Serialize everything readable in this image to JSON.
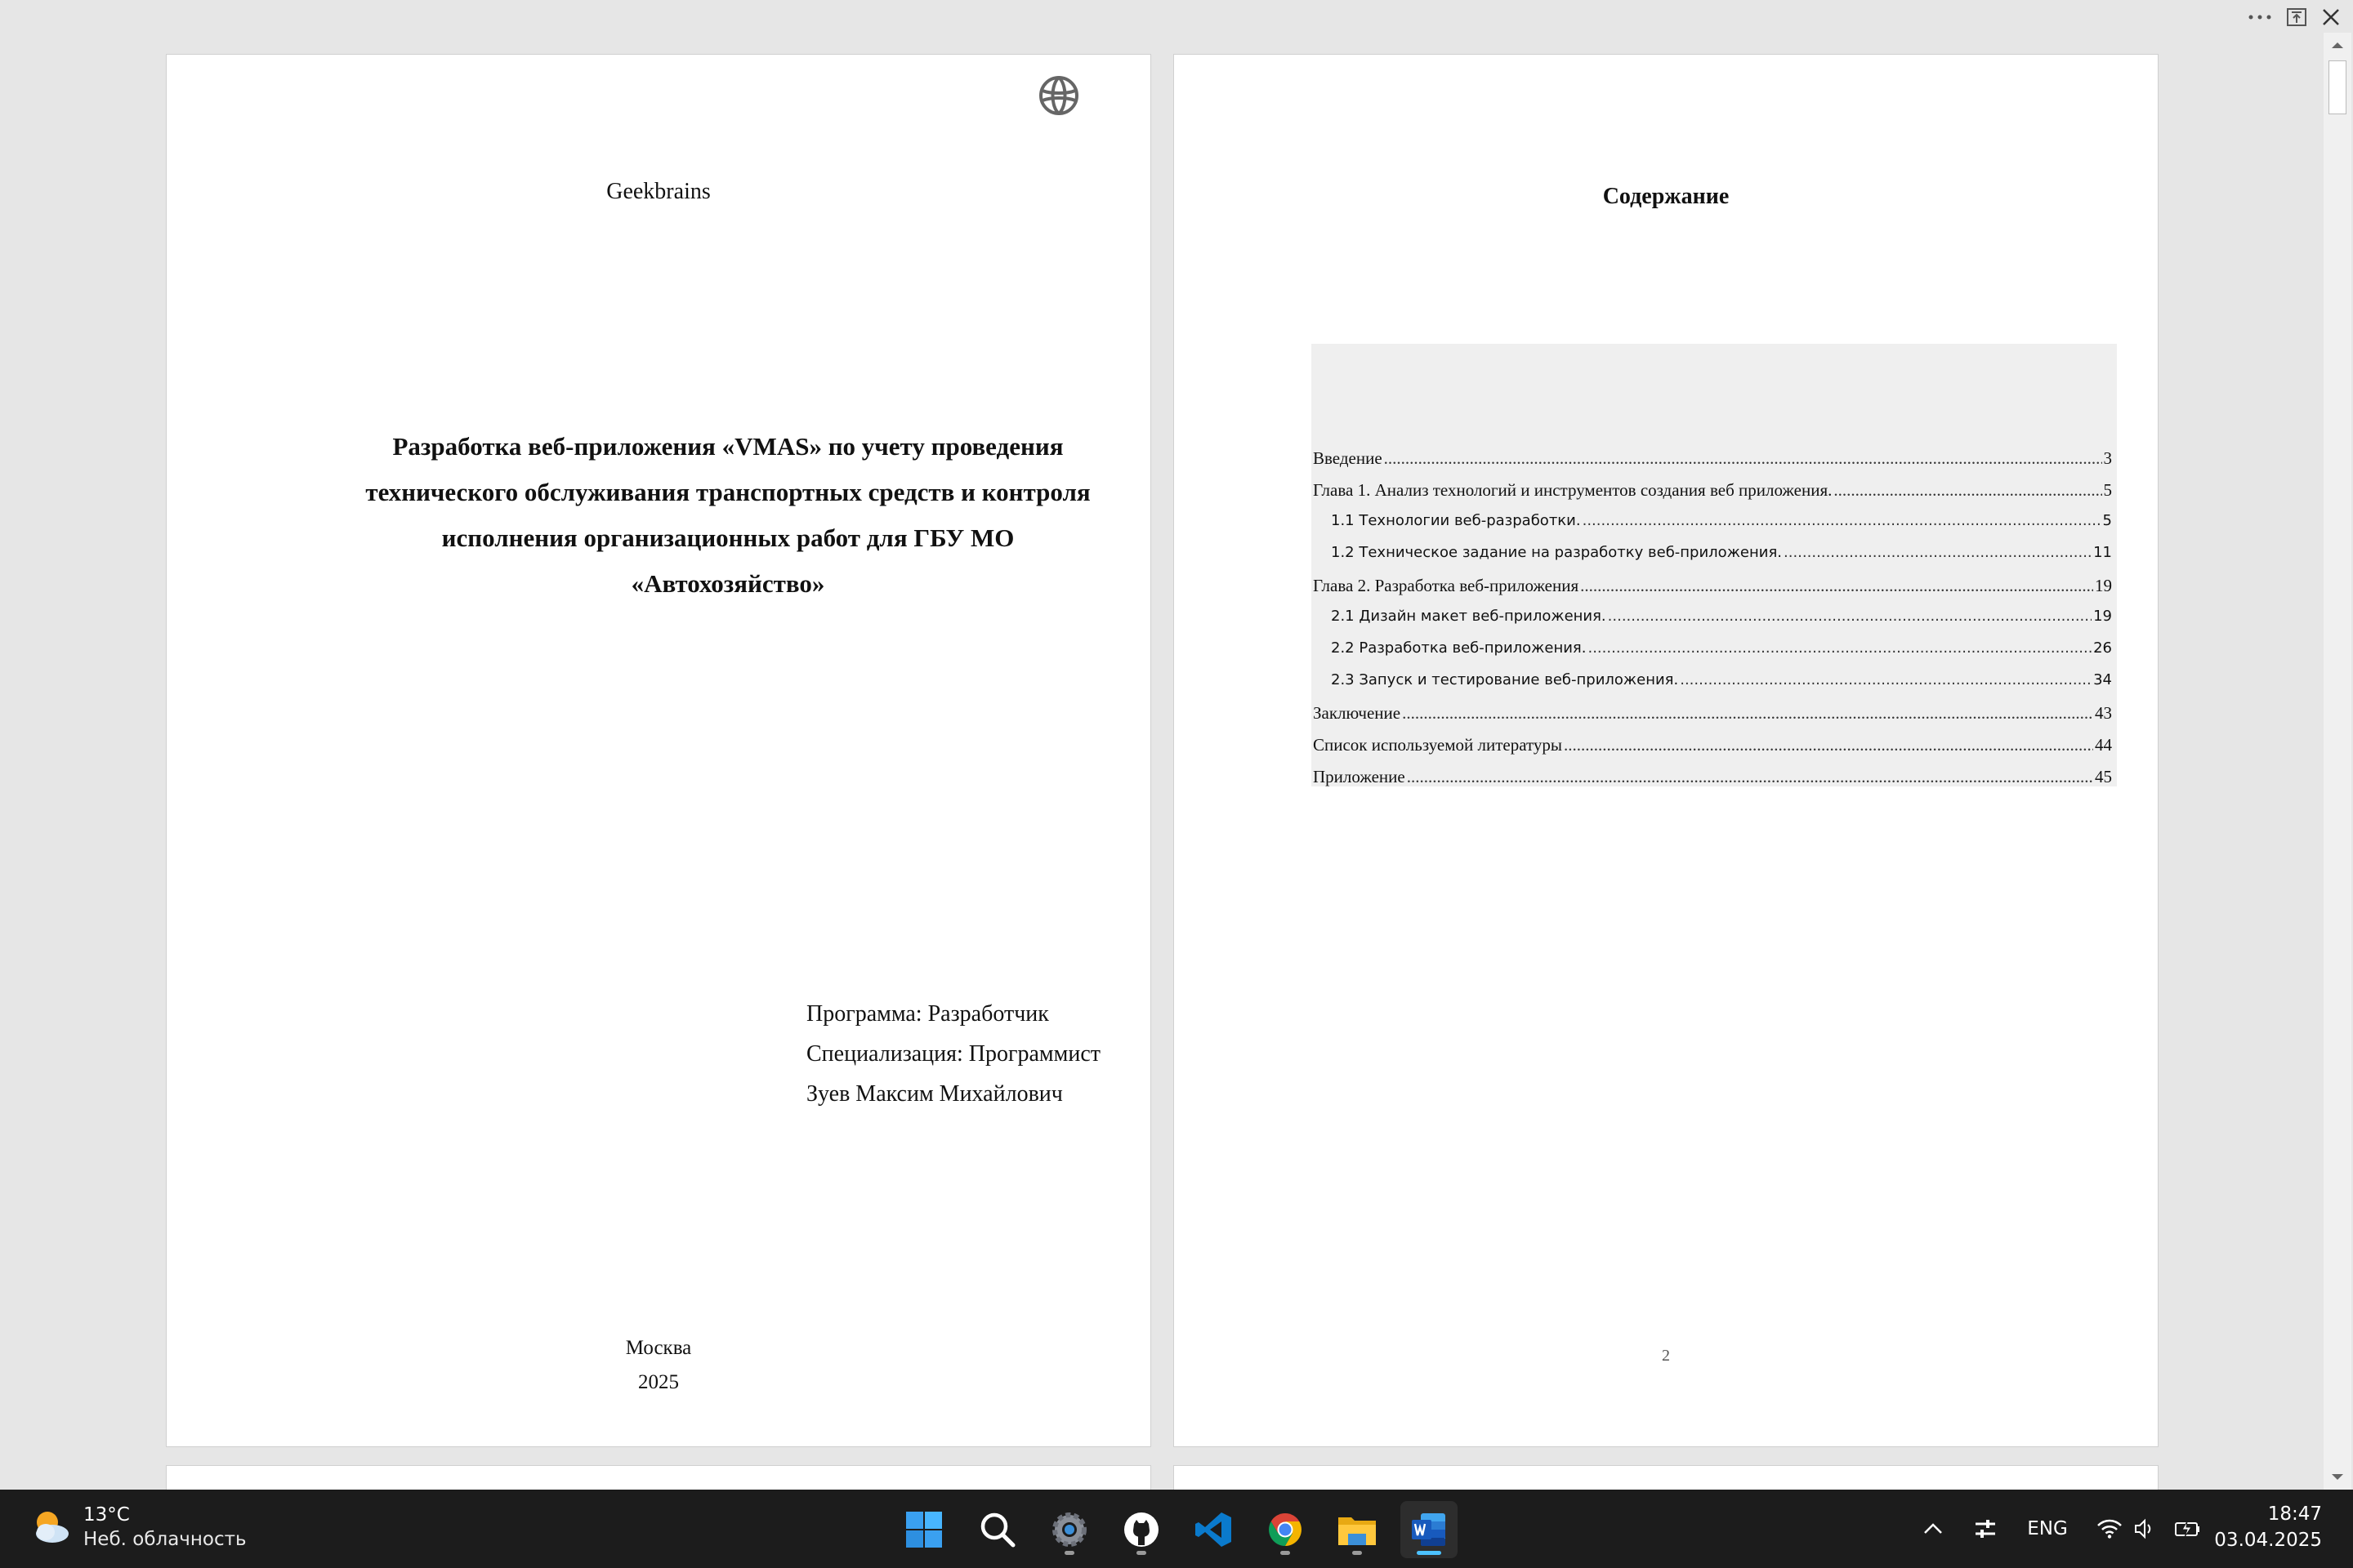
{
  "window_controls": {
    "more_icon": "more-dots-icon",
    "restore_icon": "restore-icon",
    "close_icon": "close-icon"
  },
  "page1": {
    "organization": "Geekbrains",
    "title": "Разработка веб-приложения «VMAS» по учету проведения технического обслуживания транспортных средств и контроля исполнения организационных работ для ГБУ МО «Автохозяйство»",
    "program": "Программа: Разработчик",
    "specialization": "Специализация: Программист",
    "author": "Зуев Максим Михайлович",
    "city": "Москва",
    "year": "2025"
  },
  "page2": {
    "heading": "Содержание",
    "page_number": "2",
    "toc": [
      {
        "label": "Введение",
        "page": "3",
        "level": 1
      },
      {
        "label": "Глава 1. Анализ технологий и инструментов создания веб приложения.",
        "page": "5",
        "level": 1
      },
      {
        "label": "1.1 Технологии веб-разработки.",
        "page": "5",
        "level": 2
      },
      {
        "label": "1.2 Техническое задание на разработку веб-приложения.",
        "page": "11",
        "level": 2
      },
      {
        "label": "Глава 2. Разработка веб-приложения",
        "page": "19",
        "level": 1
      },
      {
        "label": "2.1 Дизайн макет веб-приложения.",
        "page": "19",
        "level": 2
      },
      {
        "label": "2.2 Разработка веб-приложения.",
        "page": "26",
        "level": 2
      },
      {
        "label": "2.3 Запуск и тестирование веб-приложения.",
        "page": "34",
        "level": 2
      },
      {
        "label": "Заключение",
        "page": "43",
        "level": 1
      },
      {
        "label": "Список используемой литературы",
        "page": "44",
        "level": 1
      },
      {
        "label": "Приложение",
        "page": "45",
        "level": 1
      }
    ]
  },
  "taskbar": {
    "weather_temp": "13°C",
    "weather_text": "Неб. облачность",
    "apps": [
      "start-icon",
      "search-icon",
      "settings-icon",
      "github-icon",
      "vscode-icon",
      "chrome-icon",
      "file-explorer-icon",
      "word-icon"
    ],
    "language": "ENG",
    "time": "18:47",
    "date": "03.04.2025"
  },
  "colors": {
    "taskbar_bg": "#1c1c1c",
    "toc_highlight": "#efefef",
    "active_indicator": "#4cc2ff",
    "word_blue": "#185abd",
    "vscode_blue": "#0a7acc"
  }
}
